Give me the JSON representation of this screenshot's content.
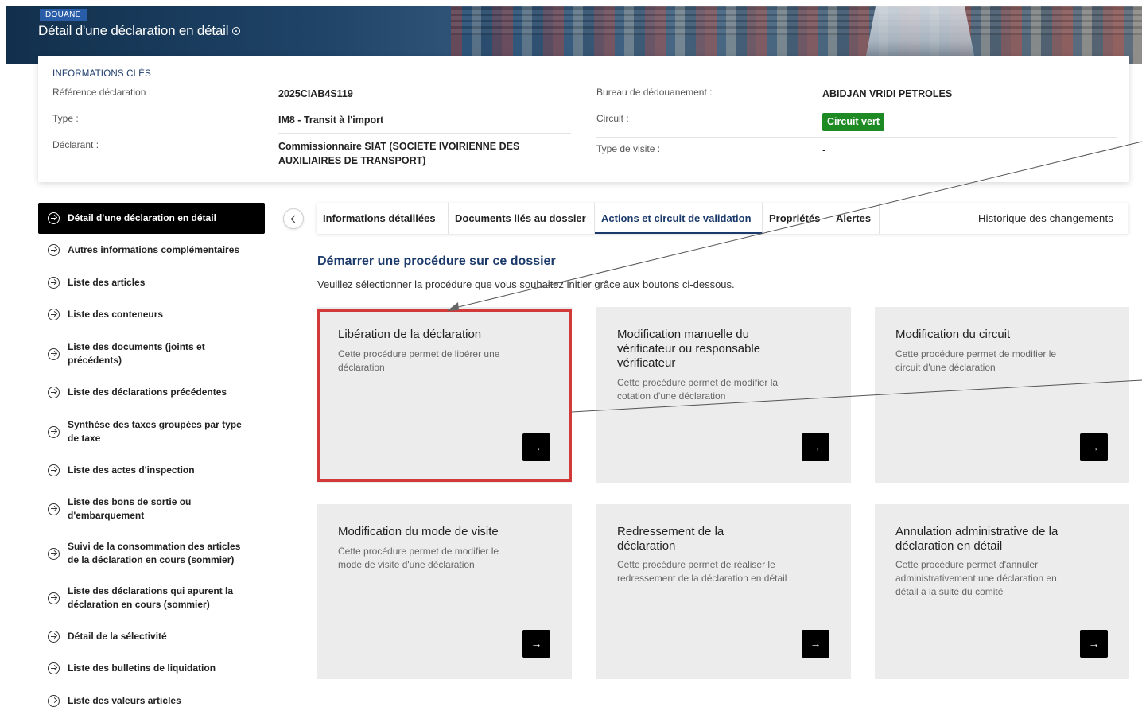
{
  "header": {
    "badge": "DOUANE",
    "title": "Détail d'une déclaration en détail"
  },
  "key_info": {
    "section_title": "INFORMATIONS CLÉS",
    "reference_label": "Référence déclaration :",
    "reference_value": "2025CIAB4S119",
    "type_label": "Type :",
    "type_value": "IM8 - Transit à l'import",
    "declarant_label": "Déclarant :",
    "declarant_value": "Commissionnaire SIAT (SOCIETE IVOIRIENNE DES AUXILIAIRES DE TRANSPORT)",
    "bureau_label": "Bureau de dédouanement :",
    "bureau_value": "ABIDJAN VRIDI PETROLES",
    "circuit_label": "Circuit :",
    "circuit_value": "Circuit vert",
    "visit_type_label": "Type de visite :",
    "visit_type_value": "-"
  },
  "sidebar": {
    "items": [
      {
        "label": "Détail d'une déclaration en détail"
      },
      {
        "label": "Autres informations complémentaires"
      },
      {
        "label": "Liste des articles"
      },
      {
        "label": "Liste des conteneurs"
      },
      {
        "label": "Liste des documents (joints et précédents)"
      },
      {
        "label": "Liste des déclarations précédentes"
      },
      {
        "label": "Synthèse des taxes groupées par type de taxe"
      },
      {
        "label": "Liste des actes d'inspection"
      },
      {
        "label": "Liste des bons de sortie ou d'embarquement"
      },
      {
        "label": "Suivi de la consommation des articles de la déclaration en cours (sommier)"
      },
      {
        "label": "Liste des déclarations qui apurent la déclaration en cours (sommier)"
      },
      {
        "label": "Détail de la sélectivité"
      },
      {
        "label": "Liste des bulletins de liquidation"
      },
      {
        "label": "Liste des valeurs articles"
      }
    ]
  },
  "tabs": [
    {
      "label": "Informations détaillées"
    },
    {
      "label": "Documents liés au dossier"
    },
    {
      "label": "Actions et circuit de validation"
    },
    {
      "label": "Propriétés"
    },
    {
      "label": "Alertes"
    },
    {
      "label": "Historique des changements"
    }
  ],
  "procedures": {
    "title": "Démarrer une procédure sur ce dossier",
    "subtitle": "Veuillez sélectionner la procédure que vous souhaitez initier grâce aux boutons ci-dessous.",
    "cards": [
      {
        "title": "Libération de la déclaration",
        "desc": "Cette procédure permet de libérer une déclaration"
      },
      {
        "title": "Modification manuelle du vérificateur ou responsable vérificateur",
        "desc": "Cette procédure permet de modifier la cotation d'une déclaration"
      },
      {
        "title": "Modification du circuit",
        "desc": "Cette procédure permet de modifier le circuit d'une déclaration"
      },
      {
        "title": "Modification du mode de visite",
        "desc": "Cette procédure permet de modifier le mode de visite d'une déclaration"
      },
      {
        "title": "Redressement de la déclaration",
        "desc": "Cette procédure permet de réaliser le redressement de la déclaration en détail"
      },
      {
        "title": "Annulation administrative de la déclaration en détail",
        "desc": "Cette procédure permet d'annuler administrativement une déclaration en détail à la suite du comité"
      }
    ],
    "go_symbol": "→"
  },
  "colors": {
    "accent": "#1b3a6b",
    "circuit_green": "#1e8a23",
    "highlight_red": "#d23a3a",
    "card_bg": "#ececec"
  }
}
